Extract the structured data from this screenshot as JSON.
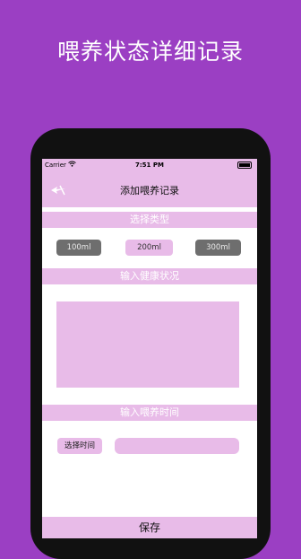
{
  "headline": "喂养状态详细记录",
  "status_bar": {
    "carrier": "Carrier",
    "time": "7:51 PM"
  },
  "nav": {
    "title": "添加喂养记录",
    "back_icon": "back-arrow-icon"
  },
  "type_section": {
    "title": "选择类型",
    "options": [
      "100ml",
      "200ml",
      "300ml"
    ],
    "selected": "200ml"
  },
  "health_section": {
    "title": "输入健康状况",
    "value": ""
  },
  "time_section": {
    "title": "输入喂养时间",
    "button_label": "选择时间",
    "value": ""
  },
  "save_label": "保存",
  "colors": {
    "background": "#9b3fc3",
    "accent": "#e8bbe8",
    "pill_grey": "#6e6e6e"
  }
}
